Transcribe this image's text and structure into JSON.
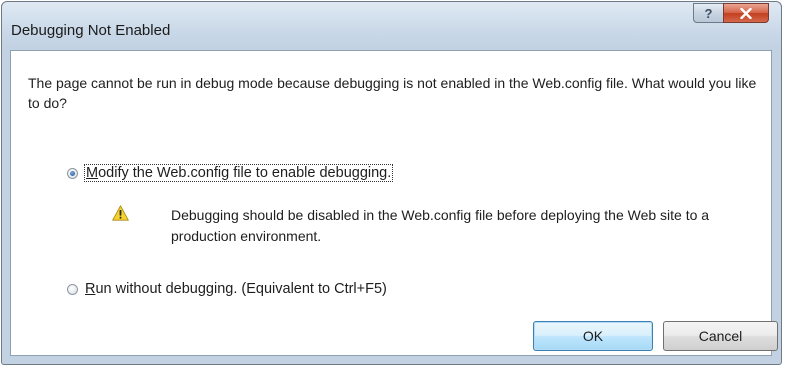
{
  "window": {
    "title": "Debugging Not Enabled",
    "help_button_glyph": "?",
    "close_button_glyph": "X"
  },
  "dialog": {
    "message": "The page cannot be run in debug mode because debugging is not enabled in the Web.config file. What would you like to do?",
    "options": [
      {
        "mnemonic": "M",
        "label_rest": "odify the Web.config file to enable debugging.",
        "selected": true
      },
      {
        "mnemonic": "R",
        "label_rest": "un without debugging. (Equivalent to Ctrl+F5)",
        "selected": false
      }
    ],
    "warning": {
      "icon": "warning-triangle-icon",
      "text": "Debugging should be disabled in the Web.config file before deploying the Web site to a production environment."
    },
    "buttons": {
      "ok_label": "OK",
      "cancel_label": "Cancel"
    }
  },
  "colors": {
    "frame": "#c2d2e3",
    "close_button": "#c2401f",
    "default_button_border": "#3c7fb1"
  }
}
